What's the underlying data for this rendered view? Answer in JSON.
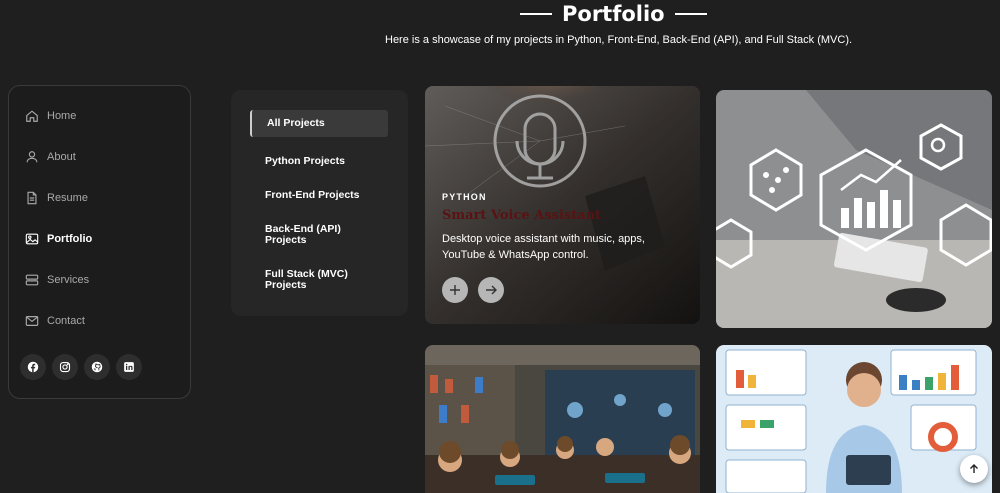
{
  "header": {
    "title": "Portfolio",
    "subtitle": "Here is a showcase of my projects in Python, Front-End, Back-End (API), and Full Stack (MVC)."
  },
  "sidebar": {
    "items": [
      {
        "label": "Home",
        "icon": "home-icon",
        "active": false
      },
      {
        "label": "About",
        "icon": "user-icon",
        "active": false
      },
      {
        "label": "Resume",
        "icon": "document-icon",
        "active": false
      },
      {
        "label": "Portfolio",
        "icon": "image-icon",
        "active": true
      },
      {
        "label": "Services",
        "icon": "server-icon",
        "active": false
      },
      {
        "label": "Contact",
        "icon": "mail-icon",
        "active": false
      }
    ],
    "socials": [
      "facebook-icon",
      "instagram-icon",
      "github-icon",
      "linkedin-icon"
    ]
  },
  "filters": {
    "items": [
      {
        "label": "All Projects",
        "active": true
      },
      {
        "label": "Python Projects",
        "active": false
      },
      {
        "label": "Front-End Projects",
        "active": false
      },
      {
        "label": "Back-End (API) Projects",
        "active": false
      },
      {
        "label": "Full Stack (MVC) Projects",
        "active": false
      }
    ]
  },
  "cards": [
    {
      "category": "PYTHON",
      "title": "Smart Voice Assistant",
      "description": "Desktop voice assistant with music, apps, YouTube & WhatsApp control."
    }
  ],
  "colors": {
    "background": "#1f1f1f",
    "panel": "#262626",
    "accent_title": "#5a1212"
  }
}
